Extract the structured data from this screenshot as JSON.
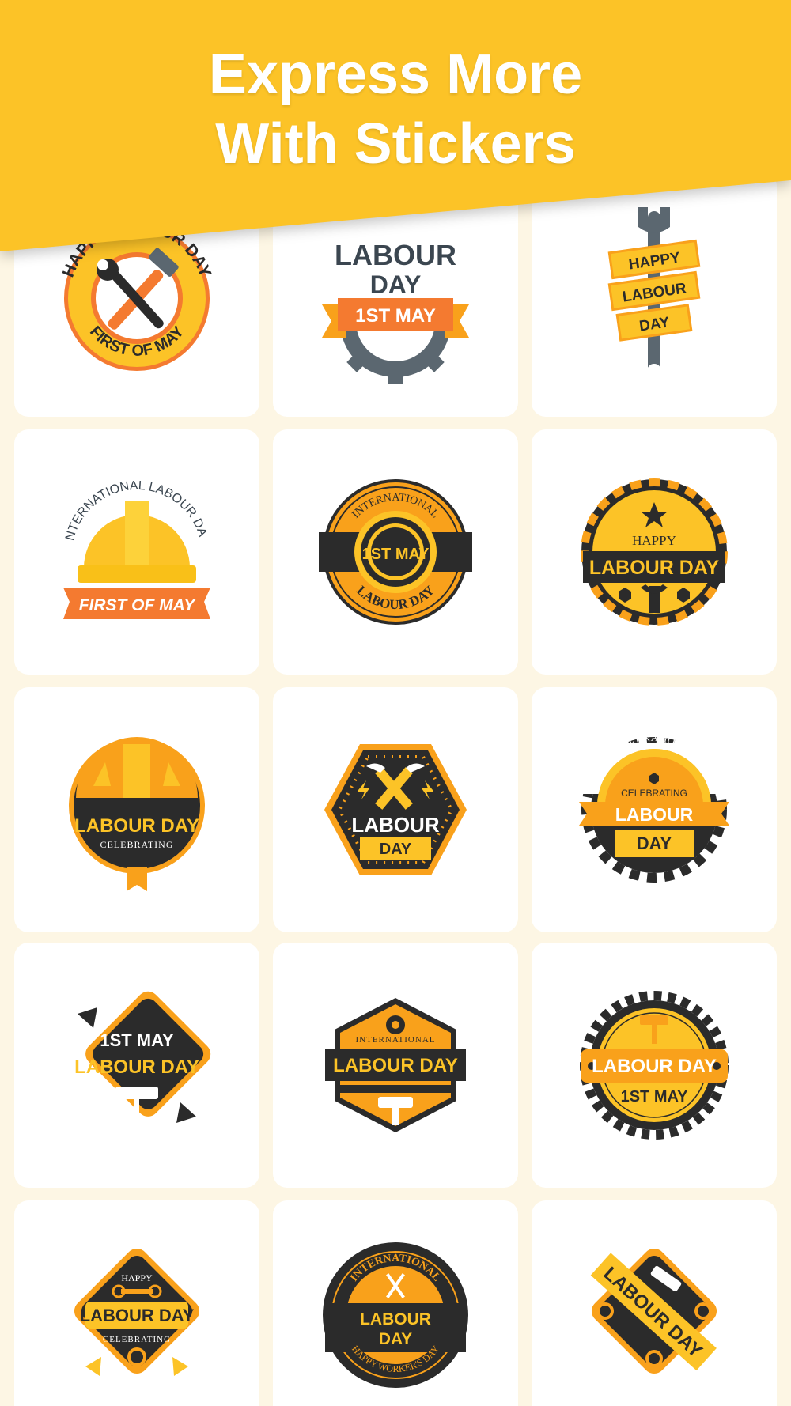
{
  "banner": {
    "title_line1": "Express More",
    "title_line2": "With Stickers",
    "background_color": "#fcc327"
  },
  "colors": {
    "page_background": "#fdf6e4",
    "card_background": "#ffffff",
    "yellow": "#fcc327",
    "orange": "#f9a11b",
    "deep_orange": "#f47a30",
    "dark": "#2b2b2b",
    "gray": "#5b6770"
  },
  "stickers": [
    {
      "name": "happy-labour-day-first-of-may-badge",
      "texts": [
        "HAPPY LABOUR DAY",
        "FIRST OF MAY"
      ],
      "icon": "hammer-wrench-icon"
    },
    {
      "name": "labour-day-1st-may-gear-badge",
      "texts": [
        "LABOUR",
        "DAY",
        "1ST MAY"
      ],
      "icon": "gear-icon"
    },
    {
      "name": "happy-labour-day-wrench-ribbon",
      "texts": [
        "HAPPY",
        "LABOUR",
        "DAY"
      ],
      "icon": "wrench-icon"
    },
    {
      "name": "international-labour-day-hardhat-badge",
      "texts": [
        "INTERNATIONAL LABOUR DAY",
        "FIRST OF MAY"
      ],
      "icon": "hardhat-icon"
    },
    {
      "name": "international-1st-may-gear-badge",
      "texts": [
        "INTERNATIONAL",
        "1ST MAY",
        "LABOUR DAY"
      ],
      "icon": "gear-icon"
    },
    {
      "name": "happy-labour-day-striped-badge",
      "texts": [
        "HAPPY",
        "LABOUR DAY"
      ],
      "icon": "wrench-icon"
    },
    {
      "name": "labour-day-celebrating-hardhat-badge",
      "texts": [
        "LABOUR DAY",
        "CELEBRATING"
      ],
      "icon": "hardhat-icon"
    },
    {
      "name": "labour-day-hexagon-hammers-badge",
      "texts": [
        "LABOUR",
        "DAY"
      ],
      "icon": "crossed-hammers-icon"
    },
    {
      "name": "international-celebrating-labour-day-gear-badge",
      "texts": [
        "INTERNATIONAL",
        "CELEBRATING",
        "LABOUR",
        "DAY"
      ],
      "icon": "gear-icon"
    },
    {
      "name": "1st-may-labour-day-diamond-badge",
      "texts": [
        "1ST MAY",
        "LABOUR DAY"
      ],
      "icon": "paint-roller-icon"
    },
    {
      "name": "international-labour-day-hexagon-badge",
      "texts": [
        "INTERNATIONAL",
        "LABOUR DAY"
      ],
      "icon": "hammer-icon"
    },
    {
      "name": "labour-day-1st-may-roller-gear-badge",
      "texts": [
        "LABOUR DAY",
        "1ST MAY"
      ],
      "icon": "paint-roller-icon"
    },
    {
      "name": "happy-labour-day-celebrating-diamond-badge",
      "texts": [
        "HAPPY",
        "LABOUR DAY",
        "CELEBRATING"
      ],
      "icon": "wrench-icon"
    },
    {
      "name": "international-labour-day-happy-workers-day-badge",
      "texts": [
        "INTERNATIONAL",
        "LABOUR",
        "DAY",
        "HAPPY WORKER'S DAY"
      ],
      "icon": "crossed-screwdrivers-icon"
    },
    {
      "name": "labour-day-diagonal-ribbon-badge",
      "texts": [
        "LABOUR DAY"
      ],
      "icon": "hammer-icon"
    }
  ]
}
